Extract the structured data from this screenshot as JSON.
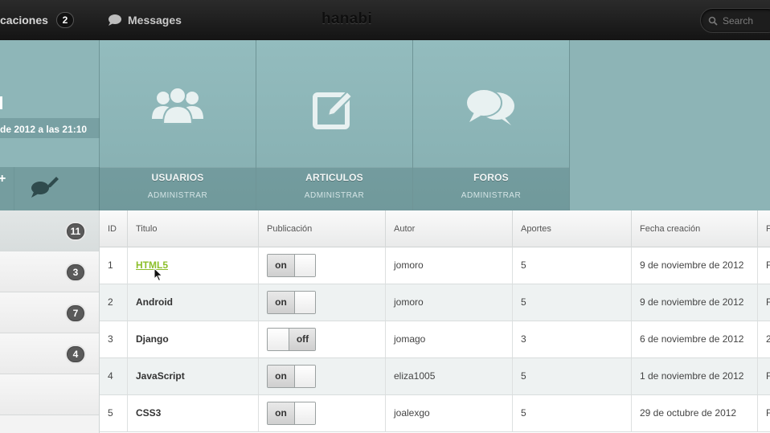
{
  "topbar": {
    "notifications_label": "caciones",
    "notifications_count": "2",
    "messages_label": "Messages",
    "brand": "hanabi",
    "search_placeholder": "Search"
  },
  "dashboard": {
    "date_text": "de 2012 a las 21:10",
    "plus_label": "+",
    "tiles": [
      {
        "label": "USUARIOS",
        "sub": "ADMINISTRAR",
        "icon": "users-icon"
      },
      {
        "label": "ARTICULOS",
        "sub": "ADMINISTRAR",
        "icon": "edit-icon"
      },
      {
        "label": "FOROS",
        "sub": "ADMINISTRAR",
        "icon": "forum-icon"
      }
    ]
  },
  "sidebar": {
    "items": [
      {
        "count": "11"
      },
      {
        "count": "3"
      },
      {
        "count": "7"
      },
      {
        "count": "4"
      },
      {
        "count": ""
      }
    ]
  },
  "table": {
    "headers": [
      "ID",
      "Titulo",
      "Publicación",
      "Autor",
      "Aportes",
      "Fecha creación",
      "F"
    ],
    "rows": [
      {
        "id": "1",
        "title": "HTML5",
        "published": "on",
        "author": "jomoro",
        "aportes": "5",
        "fecha": "9 de noviembre de 2012",
        "extra": "F"
      },
      {
        "id": "2",
        "title": "Android",
        "published": "on",
        "author": "jomoro",
        "aportes": "5",
        "fecha": "9 de noviembre de 2012",
        "extra": "F"
      },
      {
        "id": "3",
        "title": "Django",
        "published": "off",
        "author": "jomago",
        "aportes": "3",
        "fecha": "6 de noviembre de 2012",
        "extra": "2"
      },
      {
        "id": "4",
        "title": "JavaScript",
        "published": "on",
        "author": "eliza1005",
        "aportes": "5",
        "fecha": "1 de noviembre de 2012",
        "extra": "F"
      },
      {
        "id": "5",
        "title": "CSS3",
        "published": "on",
        "author": "joalexgo",
        "aportes": "5",
        "fecha": "29 de octubre de 2012",
        "extra": "F"
      }
    ]
  },
  "colors": {
    "link_hover": "#8cbf2a",
    "tile_bg": "#8fb7b9",
    "topbar_bg": "#1a1a1a"
  }
}
